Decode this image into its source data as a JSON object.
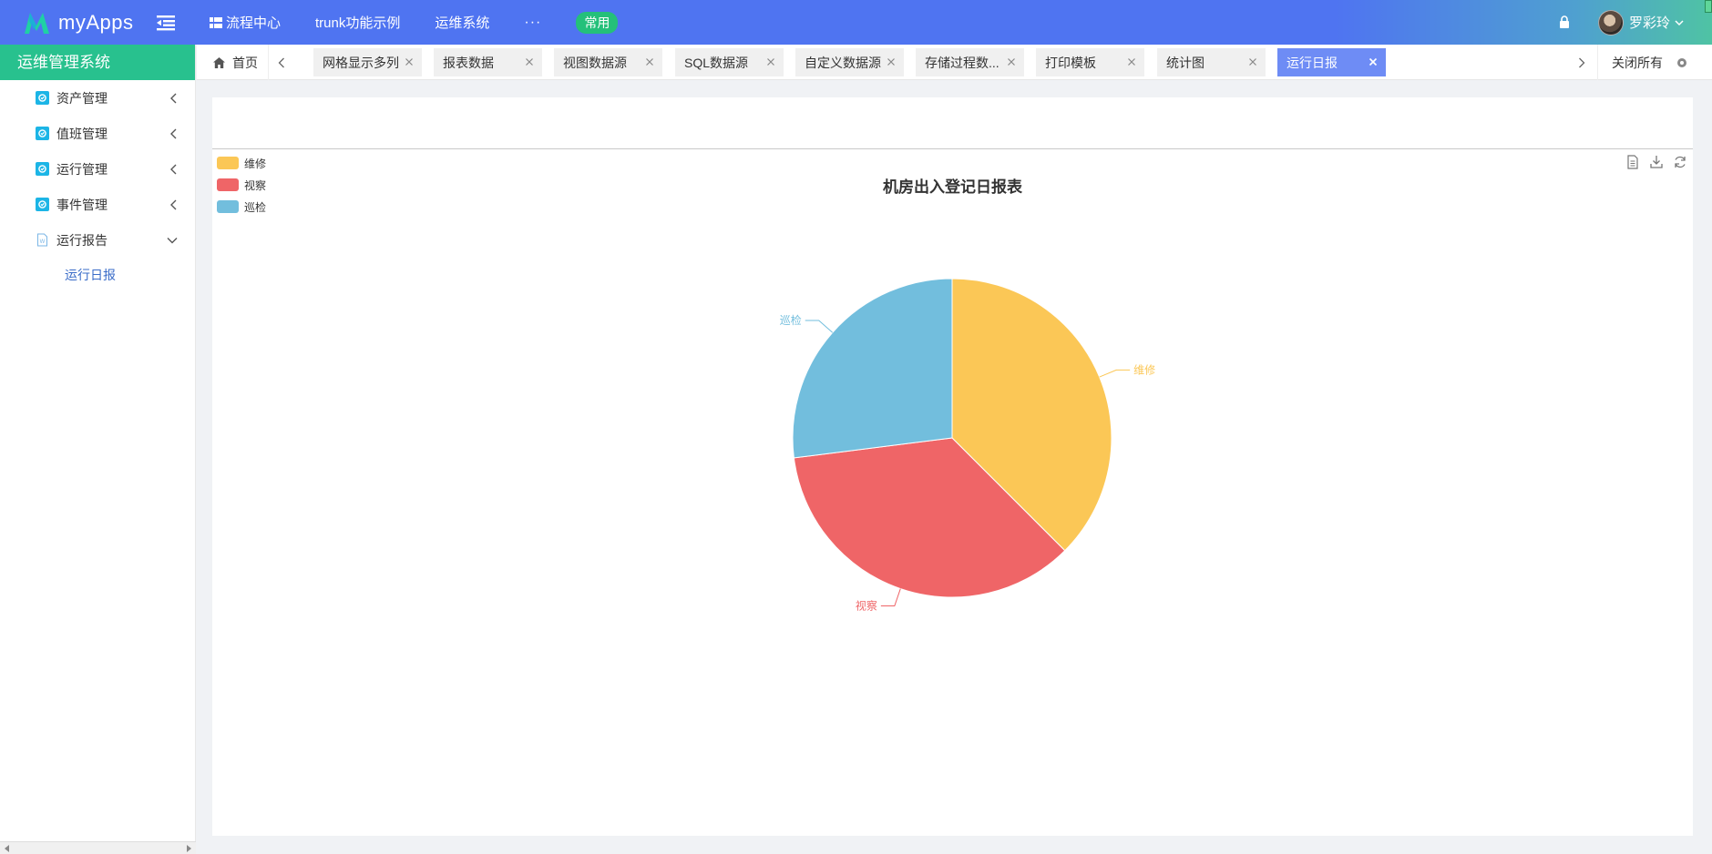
{
  "app": {
    "name": "myApps"
  },
  "topnav": {
    "items": [
      "流程中心",
      "trunk功能示例",
      "运维系统"
    ],
    "more": "···",
    "badge": "常用"
  },
  "user": {
    "name": "罗彩玲"
  },
  "sidebar": {
    "title": "运维管理系统",
    "items": [
      {
        "label": "资产管理"
      },
      {
        "label": "值班管理"
      },
      {
        "label": "运行管理"
      },
      {
        "label": "事件管理"
      },
      {
        "label": "运行报告"
      }
    ],
    "subitems": [
      "运行日报"
    ]
  },
  "tabs": {
    "home": "首页",
    "items": [
      "网格显示多列",
      "报表数据",
      "视图数据源",
      "SQL数据源",
      "自定义数据源",
      "存储过程数...",
      "打印模板",
      "统计图",
      "运行日报"
    ],
    "active": "运行日报",
    "close_all": "关闭所有"
  },
  "colors": {
    "topbar": "#4f74f1",
    "sidebar_title": "#28c18e",
    "active_tab": "#6e8cf5",
    "repair": "#fbc756",
    "inspect": "#ef6567",
    "patrol": "#72bedd"
  },
  "chart_data": {
    "type": "pie",
    "title": "机房出入登记日报表",
    "legend_position": "top-left",
    "labels": [
      "维修",
      "视察",
      "巡检"
    ],
    "values": [
      37.5,
      35.5,
      27.0
    ],
    "colors": [
      "#fbc756",
      "#ef6567",
      "#72bedd"
    ]
  }
}
